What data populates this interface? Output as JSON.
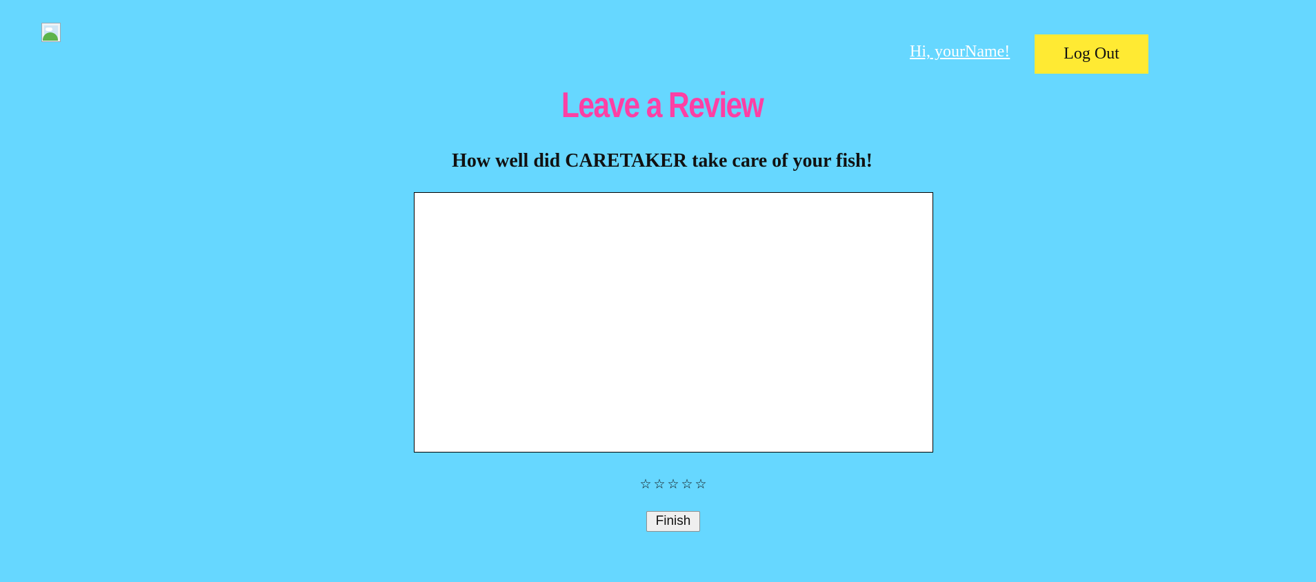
{
  "logo": {
    "icon": "broken-image-icon"
  },
  "header": {
    "greeting": "Hi, yourName!",
    "logout_label": "Log Out"
  },
  "main": {
    "title": "Leave a Review",
    "question": "How well did CARETAKER take care of your fish!",
    "review_text": "",
    "rating": {
      "max": 5,
      "selected": 0,
      "stars": [
        "☆",
        "☆",
        "☆",
        "☆",
        "☆"
      ]
    },
    "finish_label": "Finish"
  },
  "colors": {
    "background": "#66d7ff",
    "title": "#ff3fa4",
    "logout_button": "#ffea33",
    "greeting_link": "#ffffff"
  }
}
